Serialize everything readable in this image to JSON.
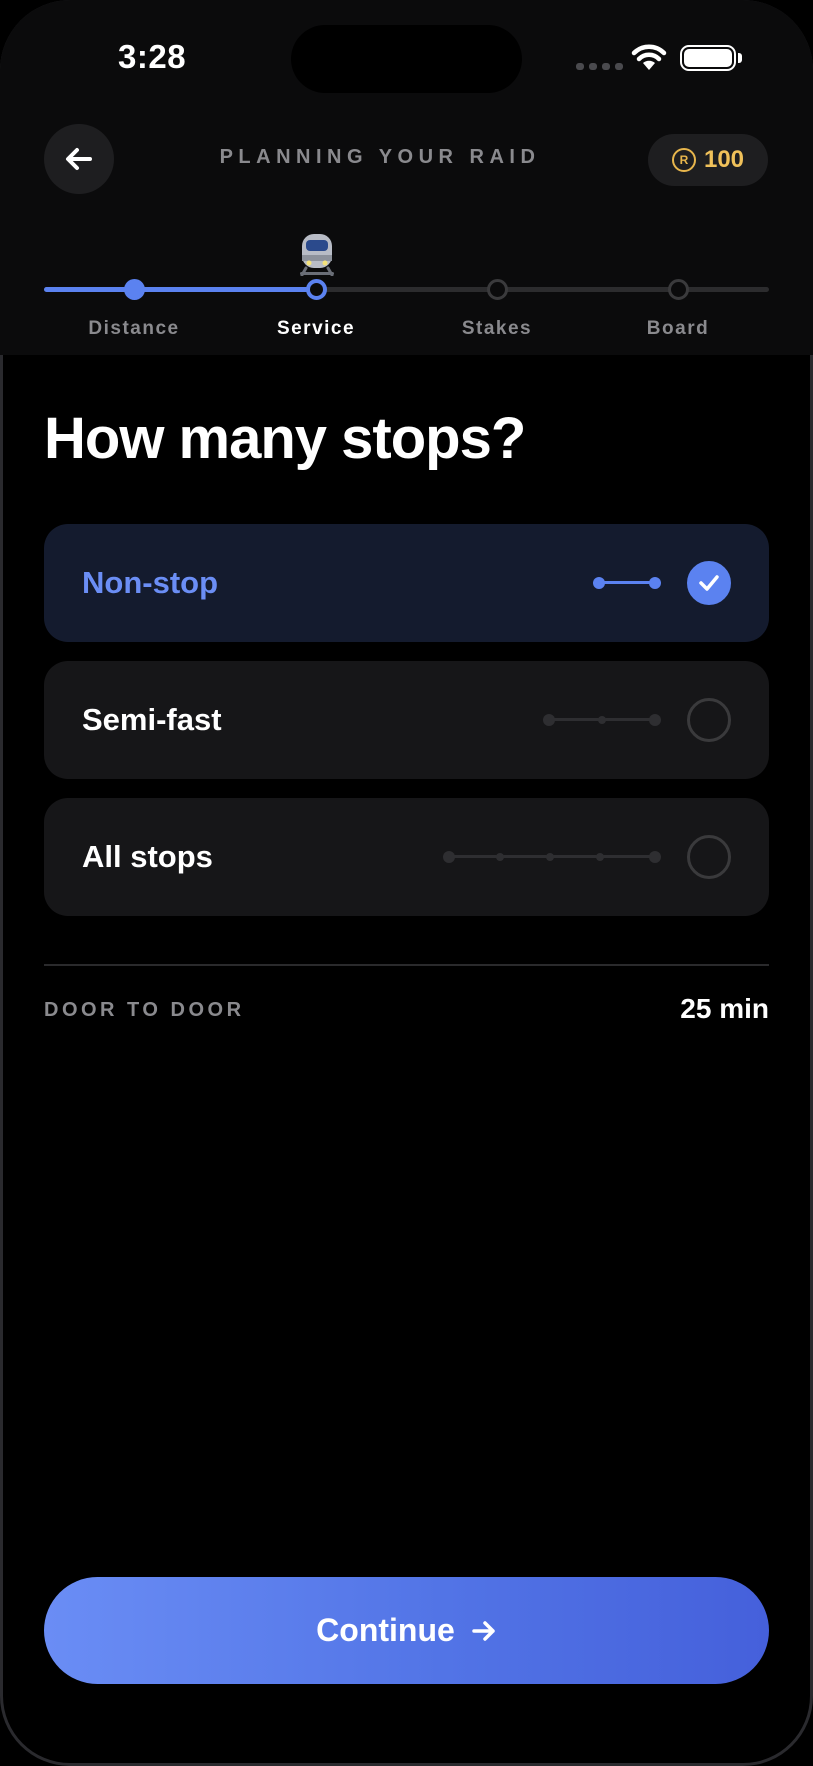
{
  "status_bar": {
    "time": "3:28"
  },
  "header": {
    "title": "PLANNING YOUR RAID",
    "coins": "100",
    "coin_symbol": "R"
  },
  "stepper": {
    "steps": [
      {
        "label": "Distance",
        "state": "done"
      },
      {
        "label": "Service",
        "state": "current"
      },
      {
        "label": "Stakes",
        "state": "todo"
      },
      {
        "label": "Board",
        "state": "todo"
      }
    ]
  },
  "main": {
    "question": "How many stops?",
    "options": [
      {
        "label": "Non-stop",
        "selected": true,
        "stops": 2
      },
      {
        "label": "Semi-fast",
        "selected": false,
        "stops": 3
      },
      {
        "label": "All stops",
        "selected": false,
        "stops": 5
      }
    ],
    "summary": {
      "label": "DOOR TO DOOR",
      "value": "25 min"
    }
  },
  "cta": {
    "label": "Continue"
  },
  "colors": {
    "accent": "#5b82f0",
    "coin": "#f0c15a",
    "background": "#000000"
  }
}
